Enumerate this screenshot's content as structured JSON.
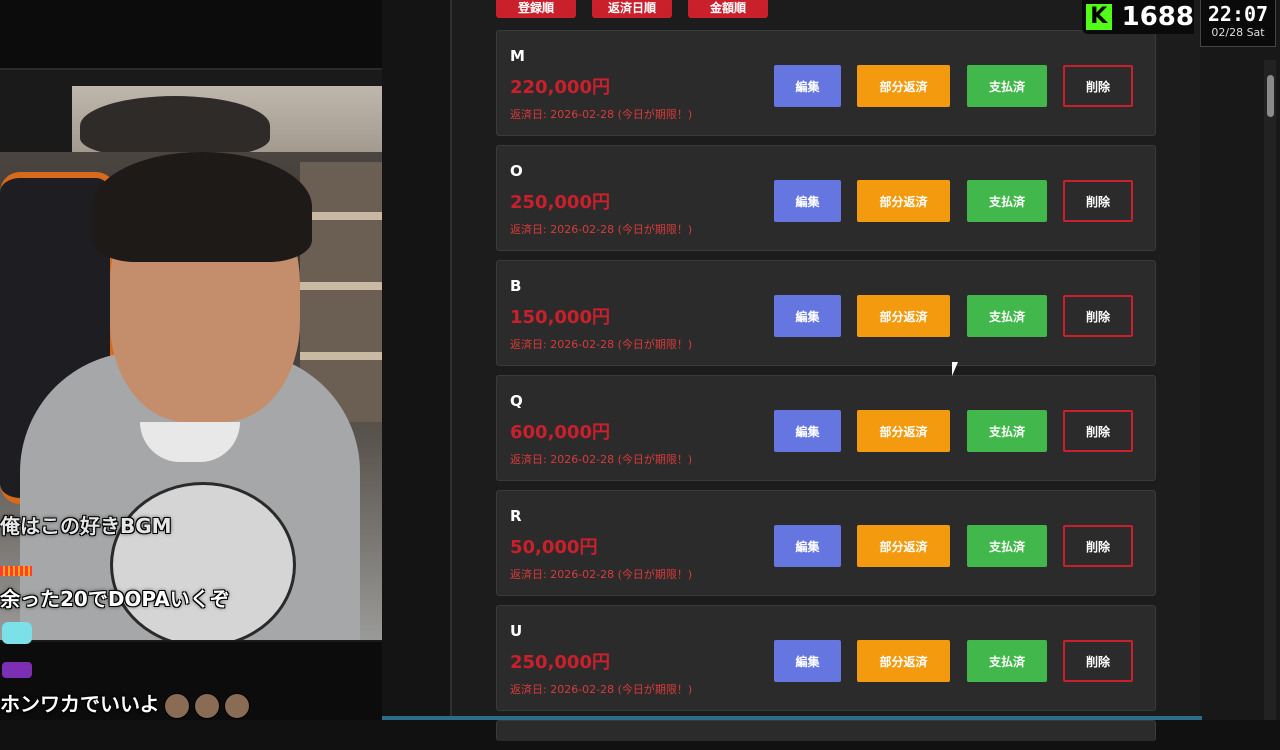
{
  "sort_buttons": [
    "登録順",
    "返済日順",
    "金額順"
  ],
  "loans": [
    {
      "name": "M",
      "amount": "220,000円",
      "due": "返済日: 2026-02-28 (今日が期限！)"
    },
    {
      "name": "O",
      "amount": "250,000円",
      "due": "返済日: 2026-02-28 (今日が期限！)"
    },
    {
      "name": "B",
      "amount": "150,000円",
      "due": "返済日: 2026-02-28 (今日が期限！)"
    },
    {
      "name": "Q",
      "amount": "600,000円",
      "due": "返済日: 2026-02-28 (今日が期限！)"
    },
    {
      "name": "R",
      "amount": "50,000円",
      "due": "返済日: 2026-02-28 (今日が期限！)"
    },
    {
      "name": "U",
      "amount": "250,000円",
      "due": "返済日: 2026-02-28 (今日が期限！)"
    }
  ],
  "actions": {
    "edit": "編集",
    "partial": "部分返済",
    "paid": "支払済",
    "delete": "削除"
  },
  "viewer_count": "1688",
  "clock": {
    "time": "22:07",
    "date": "02/28 Sat"
  },
  "chat": [
    {
      "text": "俺はこの好きBGM"
    },
    {
      "text": "余った20でDOPAいくぞ"
    },
    {
      "text": "ホンワカでいいよ"
    }
  ],
  "colors": {
    "accent_red": "#c9202c",
    "edit": "#6576e0",
    "partial": "#f39a0e",
    "paid": "#42b84c",
    "kick_green": "#53fc18"
  }
}
